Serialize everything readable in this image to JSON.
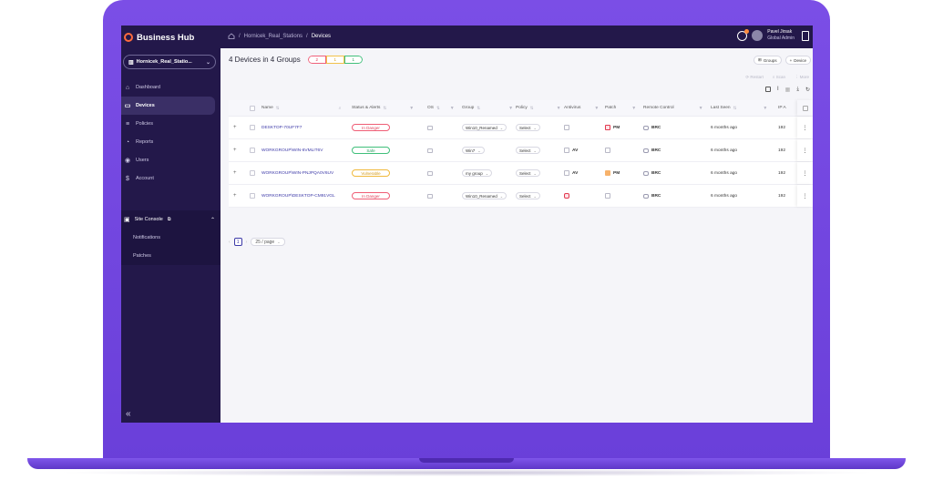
{
  "app": {
    "brand": "Business Hub"
  },
  "breadcrumb": {
    "site": "Hornicek_Real_Stations",
    "current": "Devices",
    "sep": "/"
  },
  "user": {
    "name": "Pavel Jirsak",
    "role": "Global Admin"
  },
  "sidebar": {
    "site_selector": "Hornicek_Real_Statio...",
    "items": [
      {
        "label": "Dashboard",
        "icon": "home-icon"
      },
      {
        "label": "Devices",
        "icon": "monitor-icon",
        "active": true
      },
      {
        "label": "Policies",
        "icon": "sliders-icon"
      },
      {
        "label": "Reports",
        "icon": "chart-pie-icon"
      },
      {
        "label": "Users",
        "icon": "user-icon"
      },
      {
        "label": "Account",
        "icon": "dollar-icon"
      }
    ],
    "console": {
      "label": "Site Console",
      "sub_items": [
        "Notifications",
        "Patches"
      ]
    },
    "collapse": "«"
  },
  "main": {
    "title": "4 Devices in 4 Groups",
    "counters": {
      "danger": "2",
      "warn": "1",
      "safe": "1"
    },
    "buttons": {
      "groups": "Groups",
      "device": "Device"
    },
    "actions": {
      "restart": "Restart",
      "scan": "Scan",
      "more": "More"
    }
  },
  "table": {
    "columns": {
      "name": "Name",
      "status": "Status & Alerts",
      "os": "OS",
      "group": "Group",
      "policy": "Policy",
      "antivirus": "Antivirus",
      "patch": "Patch",
      "remote": "Remote Control",
      "last_seen": "Last Seen",
      "ip": "IP A"
    },
    "rows": [
      {
        "name": "DESKTOP-70UF7F7",
        "status": "In Danger",
        "group": "Win10_Renamed",
        "policy": "Select",
        "av": "",
        "patch": "PM",
        "rc": "BRC",
        "seen": "6 months ago",
        "ip": "192"
      },
      {
        "name": "WORKGROUP\\WIN-6VMLIT6V",
        "status": "Safe",
        "group": "Win7",
        "policy": "Select",
        "av": "AV",
        "patch": "",
        "rc": "BRC",
        "seen": "6 months ago",
        "ip": "192"
      },
      {
        "name": "WORKGROUP\\WIN-PNJPQA0V6UV",
        "status": "Vulnerable",
        "group": "my group",
        "policy": "Select",
        "av": "AV",
        "patch": "PM",
        "rc": "BRC",
        "seen": "6 months ago",
        "ip": "192"
      },
      {
        "name": "WORKGROUP\\DESKTOP-CM91VGL",
        "status": "In Danger",
        "group": "Win10_Renamed",
        "policy": "Select",
        "av": "",
        "patch": "",
        "rc": "BRC",
        "seen": "6 months ago",
        "ip": "192"
      }
    ]
  },
  "pagination": {
    "page": "1",
    "page_size": "25 / page"
  },
  "colors": {
    "sidebar": "#23184a",
    "accent": "#3d3aa8",
    "frame": "#7b4ee6",
    "danger": "#e0405a",
    "safe": "#2aa060",
    "warn": "#d49a15"
  }
}
